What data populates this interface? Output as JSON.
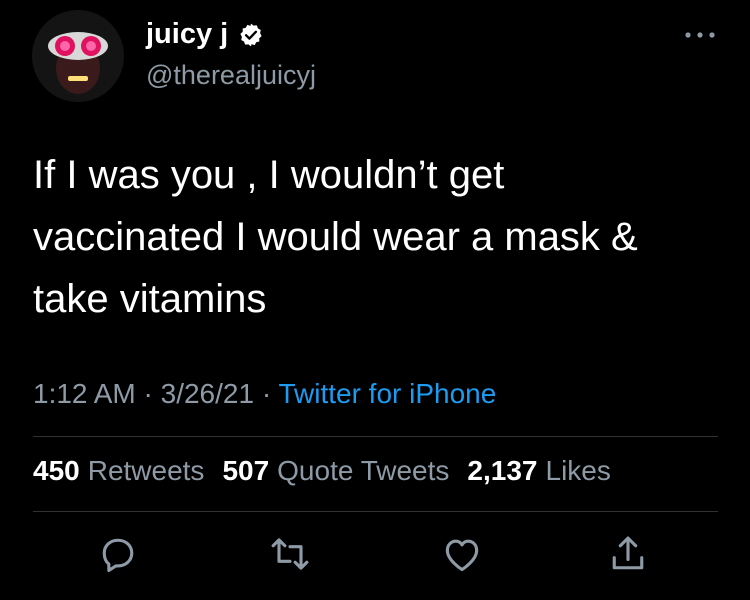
{
  "user": {
    "display_name": "juicy j",
    "handle": "@therealjuicyj",
    "verified": true
  },
  "tweet": {
    "text": "If I was you , I wouldn’t get\nvaccinated I would wear a mask &\ntake vitamins",
    "time": "1:12 AM",
    "separator": " · ",
    "date": "3/26/21",
    "source": "Twitter for iPhone"
  },
  "stats": {
    "retweets_count": "450",
    "retweets_label": "Retweets",
    "quotes_count": "507",
    "quotes_label": "Quote Tweets",
    "likes_count": "2,137",
    "likes_label": "Likes"
  },
  "icons": {
    "more": "more-options-icon",
    "verified": "verified-badge-icon",
    "reply": "reply-icon",
    "retweet": "retweet-icon",
    "like": "like-icon",
    "share": "share-icon"
  },
  "colors": {
    "background": "#000000",
    "text": "#ffffff",
    "secondary_text": "#8e9aa5",
    "link": "#1d9bf0",
    "divider": "#2f3336"
  }
}
